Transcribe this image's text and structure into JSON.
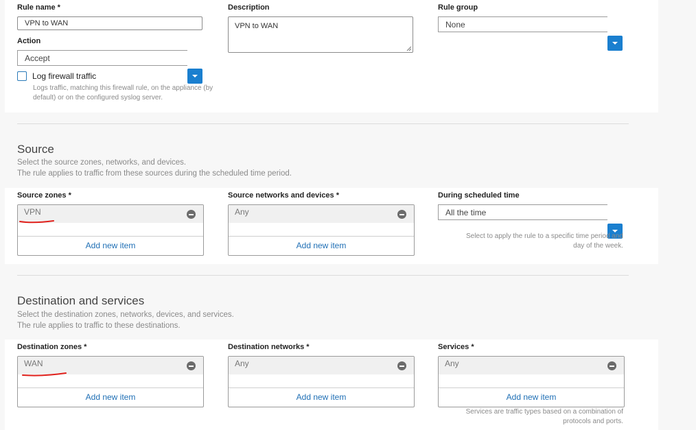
{
  "top": {
    "rule_name_label": "Rule name *",
    "rule_name_value": "VPN to WAN",
    "description_label": "Description",
    "description_value": "VPN to WAN",
    "rule_group_label": "Rule group",
    "rule_group_value": "None",
    "action_label": "Action",
    "action_value": "Accept",
    "log_label": "Log firewall traffic",
    "log_checked": false,
    "log_help_1": "Logs traffic, matching this firewall rule, on the appliance (by",
    "log_help_2": "default) or on the configured syslog server."
  },
  "source": {
    "title": "Source",
    "desc_1": "Select the source zones, networks, and devices.",
    "desc_2": "The rule applies to traffic from these sources during the scheduled time period.",
    "zones_label": "Source zones *",
    "zones_item": "VPN",
    "networks_label": "Source networks and devices *",
    "networks_item": "Any",
    "schedule_label": "During scheduled time",
    "schedule_value": "All the time",
    "schedule_help_1": "Select to apply the rule to a specific time period and",
    "schedule_help_2": "day of the week.",
    "add_item": "Add new item"
  },
  "destination": {
    "title": "Destination and services",
    "desc_1": "Select the destination zones, networks, devices, and services.",
    "desc_2": "The rule applies to traffic to these destinations.",
    "zones_label": "Destination zones *",
    "zones_item": "WAN",
    "networks_label": "Destination networks *",
    "networks_item": "Any",
    "services_label": "Services *",
    "services_item": "Any",
    "services_help_1": "Services are traffic types based on a combination of",
    "services_help_2": "protocols and ports.",
    "add_item": "Add new item"
  },
  "colors": {
    "accent": "#1a7fcf",
    "link": "#1f6fb5",
    "annotation": "#e0201b"
  },
  "icons": {
    "select_toggle": "chevron-down-icon",
    "remove_item": "minus-circle-icon",
    "resize_handle": "resize-grip-icon"
  }
}
